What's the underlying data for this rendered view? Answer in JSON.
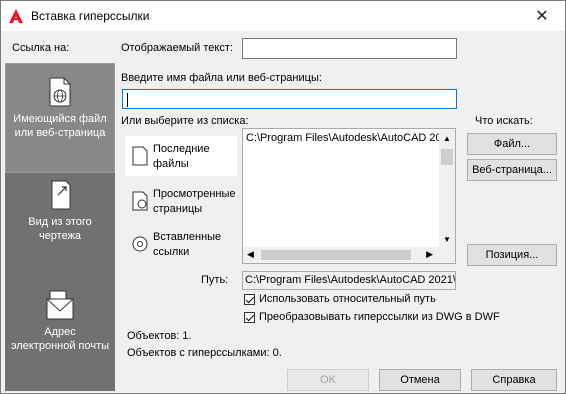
{
  "window": {
    "title": "Вставка гиперссылки"
  },
  "link_to": {
    "label": "Ссылка на:",
    "items": [
      {
        "label_1": "Имеющийся файл",
        "label_2": "или веб-страница",
        "icon": "document-globe-icon",
        "selected": true
      },
      {
        "label_1": "Вид из этого",
        "label_2": "чертежа",
        "icon": "document-arrow-icon",
        "selected": false
      },
      {
        "label_1": "Адрес",
        "label_2": "электронной почты",
        "icon": "envelope-icon",
        "selected": false
      }
    ]
  },
  "display_text": {
    "label": "Отображаемый текст:",
    "value": ""
  },
  "filename": {
    "label": "Введите имя файла или веб-страницы:",
    "value": ""
  },
  "select_list": {
    "label": "Или выберите из списка:"
  },
  "look_in": {
    "items": [
      {
        "label_1": "Последние",
        "label_2": "файлы"
      },
      {
        "label_1": "Просмотренные",
        "label_2": "страницы"
      },
      {
        "label_1": "Вставленные",
        "label_2": "ссылки"
      }
    ]
  },
  "file_list": {
    "items": [
      "C:\\Program Files\\Autodesk\\AutoCAD 20"
    ]
  },
  "browse": {
    "label": "Что искать:",
    "file_button": "Файл...",
    "web_button": "Веб-страница..."
  },
  "position_button": "Позиция...",
  "path": {
    "label": "Путь:",
    "value": "C:\\Program Files\\Autodesk\\AutoCAD 2021\\"
  },
  "options": {
    "relative_path": {
      "label": "Использовать относительный путь",
      "checked": true
    },
    "convert_dwf": {
      "label": "Преобразовывать гиперссылки из DWG в DWF",
      "checked": true
    }
  },
  "status": {
    "objects": "Объектов: 1.",
    "objects_with_links": "Объектов с гиперссылками: 0."
  },
  "buttons": {
    "ok": "OK",
    "cancel": "Отмена",
    "help": "Справка"
  },
  "colors": {
    "accent": "#0078d7",
    "panel": "#717171",
    "brand": "#e51a24"
  }
}
